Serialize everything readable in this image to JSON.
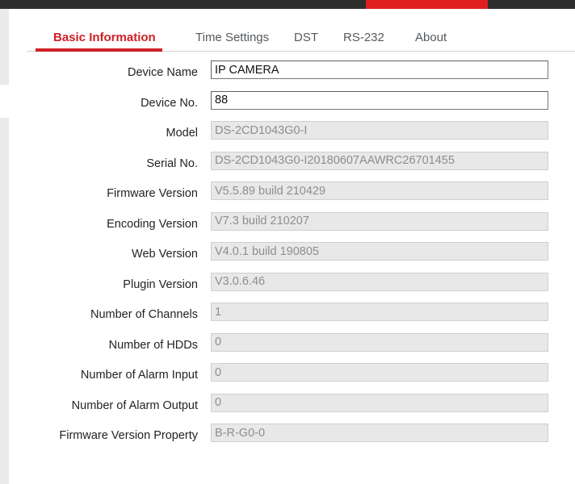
{
  "window": {
    "chrome_bar_color": "#2d2d2d",
    "accent_color": "#e01f1f"
  },
  "theme": {
    "active_tab_color": "#cf2026",
    "tab_color": "#555a5e",
    "label_color": "#232323",
    "readonly_value_color": "#8b8e91",
    "readonly_field_bg": "#e8e8e8"
  },
  "tabs": [
    {
      "id": "basic-information",
      "label": "Basic Information",
      "active": true
    },
    {
      "id": "time-settings",
      "label": "Time Settings",
      "active": false
    },
    {
      "id": "dst",
      "label": "DST",
      "active": false
    },
    {
      "id": "rs-232",
      "label": "RS-232",
      "active": false
    },
    {
      "id": "about",
      "label": "About",
      "active": false
    }
  ],
  "form": {
    "rows": [
      {
        "id": "device-name",
        "label": "Device Name",
        "value": "IP CAMERA",
        "readonly": false
      },
      {
        "id": "device-no",
        "label": "Device No.",
        "value": "88",
        "readonly": false
      },
      {
        "id": "model",
        "label": "Model",
        "value": "DS-2CD1043G0-I",
        "readonly": true
      },
      {
        "id": "serial-no",
        "label": "Serial No.",
        "value": "DS-2CD1043G0-I20180607AAWRC26701455",
        "readonly": true
      },
      {
        "id": "firmware-version",
        "label": "Firmware Version",
        "value": "V5.5.89 build 210429",
        "readonly": true
      },
      {
        "id": "encoding-version",
        "label": "Encoding Version",
        "value": "V7.3 build 210207",
        "readonly": true
      },
      {
        "id": "web-version",
        "label": "Web Version",
        "value": "V4.0.1 build 190805",
        "readonly": true
      },
      {
        "id": "plugin-version",
        "label": "Plugin Version",
        "value": "V3.0.6.46",
        "readonly": true
      },
      {
        "id": "number-of-channels",
        "label": "Number of Channels",
        "value": "1",
        "readonly": true
      },
      {
        "id": "number-of-hdds",
        "label": "Number of HDDs",
        "value": "0",
        "readonly": true
      },
      {
        "id": "number-of-alarm-input",
        "label": "Number of Alarm Input",
        "value": "0",
        "readonly": true
      },
      {
        "id": "number-of-alarm-output",
        "label": "Number of Alarm Output",
        "value": "0",
        "readonly": true
      },
      {
        "id": "firmware-version-property",
        "label": "Firmware Version Property",
        "value": "B-R-G0-0",
        "readonly": true
      }
    ]
  }
}
